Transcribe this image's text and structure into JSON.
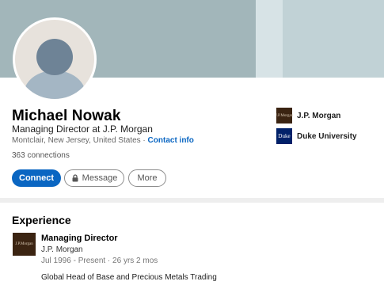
{
  "profile": {
    "name": "Michael Nowak",
    "headline": "Managing Director at J.P. Morgan",
    "location": "Montclair, New Jersey, United States",
    "separator": " · ",
    "contact_link": "Contact info",
    "connections": "363 connections"
  },
  "actions": {
    "connect": "Connect",
    "message": "Message",
    "more": "More"
  },
  "orgs": [
    {
      "name": "J.P. Morgan",
      "logo_text": "J.P.Morgan",
      "icon": "jp-morgan-logo"
    },
    {
      "name": "Duke University",
      "logo_text": "Duke",
      "icon": "duke-logo"
    }
  ],
  "experience": {
    "heading": "Experience",
    "items": [
      {
        "title": "Managing Director",
        "company": "J.P. Morgan",
        "dates": "Jul 1996 - Present · 26 yrs 2 mos",
        "description": "Global Head of Base and Precious Metals Trading",
        "logo_text": "J.P.Morgan"
      }
    ]
  },
  "colors": {
    "accent": "#0a66c2",
    "banner": "#a2b6ba",
    "jpm_logo": "#3b2412",
    "duke_logo": "#012169"
  }
}
